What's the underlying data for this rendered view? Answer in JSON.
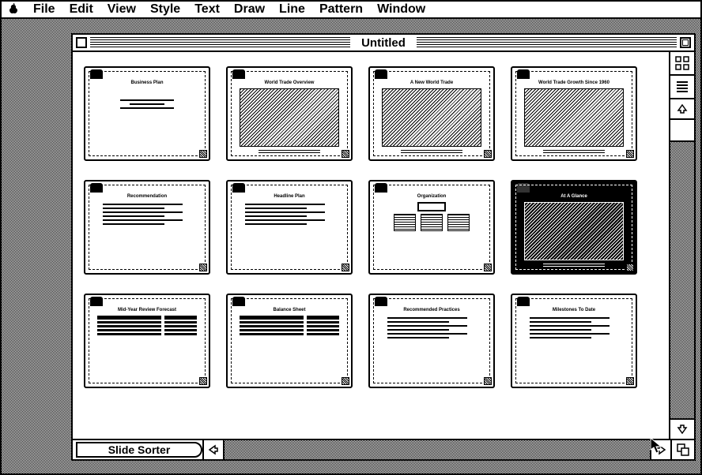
{
  "menubar": {
    "items": [
      "File",
      "Edit",
      "View",
      "Style",
      "Text",
      "Draw",
      "Line",
      "Pattern",
      "Window"
    ]
  },
  "window": {
    "title": "Untitled",
    "view_tab_label": "Slide Sorter"
  },
  "slides": [
    {
      "title": "Business Plan",
      "layout": "title"
    },
    {
      "title": "World Trade Overview",
      "layout": "image"
    },
    {
      "title": "A New World Trade",
      "layout": "image"
    },
    {
      "title": "World Trade Growth Since 1960",
      "layout": "chart"
    },
    {
      "title": "Recommendation",
      "layout": "bullets"
    },
    {
      "title": "Headline Plan",
      "layout": "bullets"
    },
    {
      "title": "Organization",
      "layout": "org"
    },
    {
      "title": "At A Glance",
      "layout": "dark"
    },
    {
      "title": "Mid-Year Review Forecast",
      "layout": "table"
    },
    {
      "title": "Balance Sheet",
      "layout": "table"
    },
    {
      "title": "Recommended Practices",
      "layout": "bullets"
    },
    {
      "title": "Milestones To Date",
      "layout": "bullets"
    }
  ],
  "icons": {
    "apple": "apple-icon",
    "grid_view": "grid-view-icon",
    "outline_view": "outline-view-icon",
    "up_arrow": "up-arrow-icon",
    "down_arrow": "down-arrow-icon",
    "left_arrow": "left-arrow-icon",
    "right_arrow": "right-arrow-icon",
    "size_box": "size-box-icon"
  }
}
